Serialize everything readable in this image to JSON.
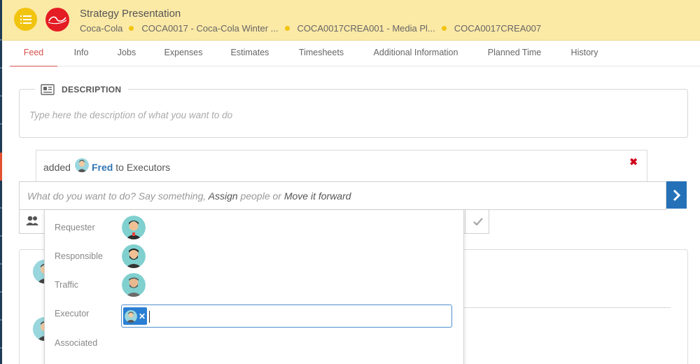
{
  "header": {
    "title": "Strategy Presentation",
    "brand_colors": {
      "header_bg": "#fbe9a6",
      "menu_button": "#f1c40f",
      "logo_red": "#e41c23"
    },
    "breadcrumbs": [
      {
        "label": "Coca-Cola"
      },
      {
        "label": "COCA0017 - Coca-Cola Winter ..."
      },
      {
        "label": "COCA0017CREA001 - Media Pl..."
      },
      {
        "label": "COCA0017CREA007"
      }
    ]
  },
  "tabs": [
    {
      "label": "Feed",
      "active": true
    },
    {
      "label": "Info"
    },
    {
      "label": "Jobs"
    },
    {
      "label": "Expenses"
    },
    {
      "label": "Estimates"
    },
    {
      "label": "Timesheets"
    },
    {
      "label": "Additional Information"
    },
    {
      "label": "Planned Time"
    },
    {
      "label": "History"
    }
  ],
  "description": {
    "heading": "DESCRIPTION",
    "placeholder": "Type here the description of what you want to do"
  },
  "activity": {
    "prefix": "added",
    "person": "Fred",
    "suffix": "to Executors"
  },
  "composer": {
    "part1": "What do you want to do? Say something, ",
    "assign": "Assign",
    "part2": " people or ",
    "move": "Move it forward"
  },
  "roles": {
    "requester": "Requester",
    "responsible": "Responsible",
    "traffic": "Traffic",
    "executor": "Executor",
    "associated": "Associated"
  },
  "accent": {
    "primary_blue": "#2471b8",
    "link_blue": "#2f75b5",
    "close_red": "#d0021b",
    "tab_active": "#d9534f"
  }
}
